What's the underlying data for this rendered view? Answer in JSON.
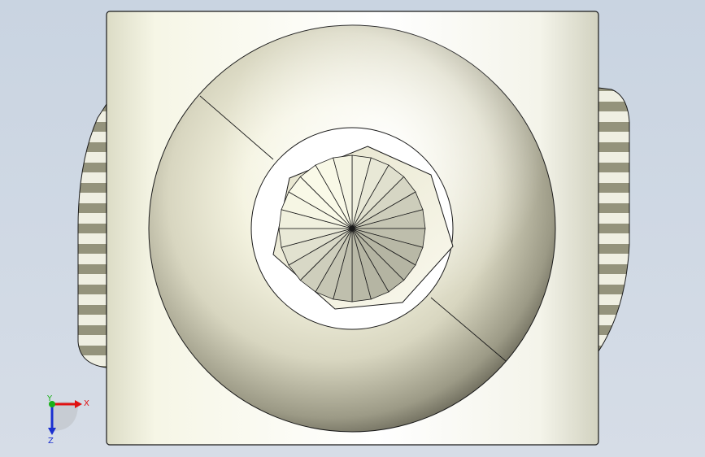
{
  "triad": {
    "x_label": "X",
    "y_label": "Y",
    "z_label": "Z",
    "x_color": "#e01010",
    "y_color": "#18b018",
    "z_color": "#1a2fd0"
  },
  "model": {
    "body_color": "#f4f4e4",
    "shade_color": "#8c8c78",
    "edge_color": "#1a1a1a",
    "background_color": "#cdd6e2"
  }
}
